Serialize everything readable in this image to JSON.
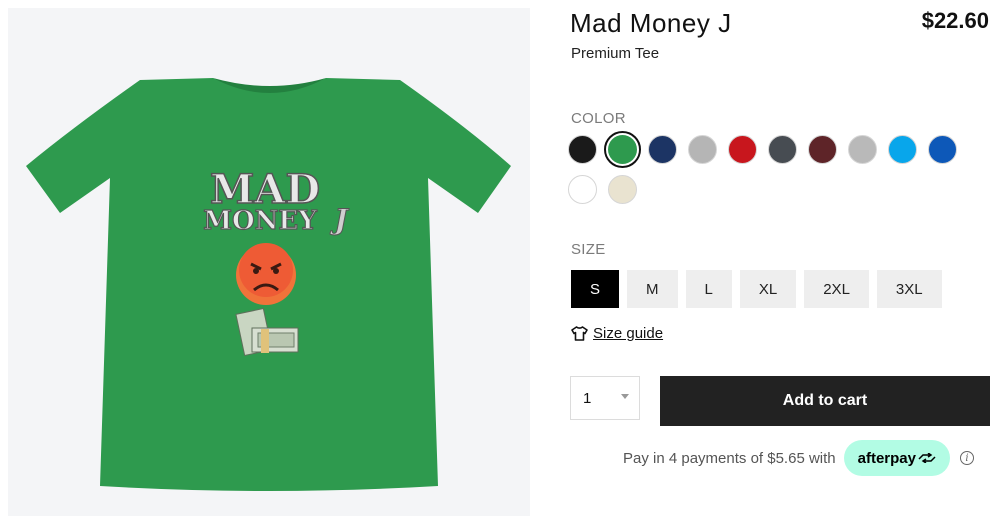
{
  "product": {
    "title": "Mad Money J",
    "subtitle": "Premium Tee",
    "price": "$22.60",
    "shirt_color": "#2e9a4e",
    "print_text_line1": "MAD",
    "print_text_line2": "MONEY",
    "print_text_j": "J",
    "print_emoji": "angry-face-emoji",
    "print_cash": "cash-stack-icon"
  },
  "color_section": {
    "label": "COLOR",
    "swatches": [
      {
        "name": "black",
        "hex": "#1a1a1a",
        "selected": false
      },
      {
        "name": "green",
        "hex": "#2e9a4e",
        "selected": true
      },
      {
        "name": "navy",
        "hex": "#1c3464",
        "selected": false
      },
      {
        "name": "light-gray",
        "hex": "#b5b5b5",
        "selected": false
      },
      {
        "name": "red",
        "hex": "#c8161d",
        "selected": false
      },
      {
        "name": "charcoal",
        "hex": "#474c52",
        "selected": false
      },
      {
        "name": "maroon",
        "hex": "#5e2428",
        "selected": false
      },
      {
        "name": "silver",
        "hex": "#b9b9b9",
        "selected": false
      },
      {
        "name": "sky-blue",
        "hex": "#08a6eb",
        "selected": false
      },
      {
        "name": "royal-blue",
        "hex": "#0d58b8",
        "selected": false
      },
      {
        "name": "white",
        "hex": "#ffffff",
        "selected": false
      },
      {
        "name": "cream",
        "hex": "#e9e3d0",
        "selected": false
      }
    ]
  },
  "size_section": {
    "label": "SIZE",
    "sizes": [
      "S",
      "M",
      "L",
      "XL",
      "2XL",
      "3XL"
    ],
    "selected": "S"
  },
  "size_guide": {
    "label": "Size guide",
    "icon": "tshirt-icon"
  },
  "quantity": {
    "value": "1"
  },
  "cart": {
    "add_label": "Add to cart",
    "button_color": "#222222"
  },
  "afterpay": {
    "text": "Pay in 4 payments of $5.65 with",
    "brand": "afterpay",
    "badge_color": "#b2fce4",
    "info_icon": "info-icon"
  }
}
